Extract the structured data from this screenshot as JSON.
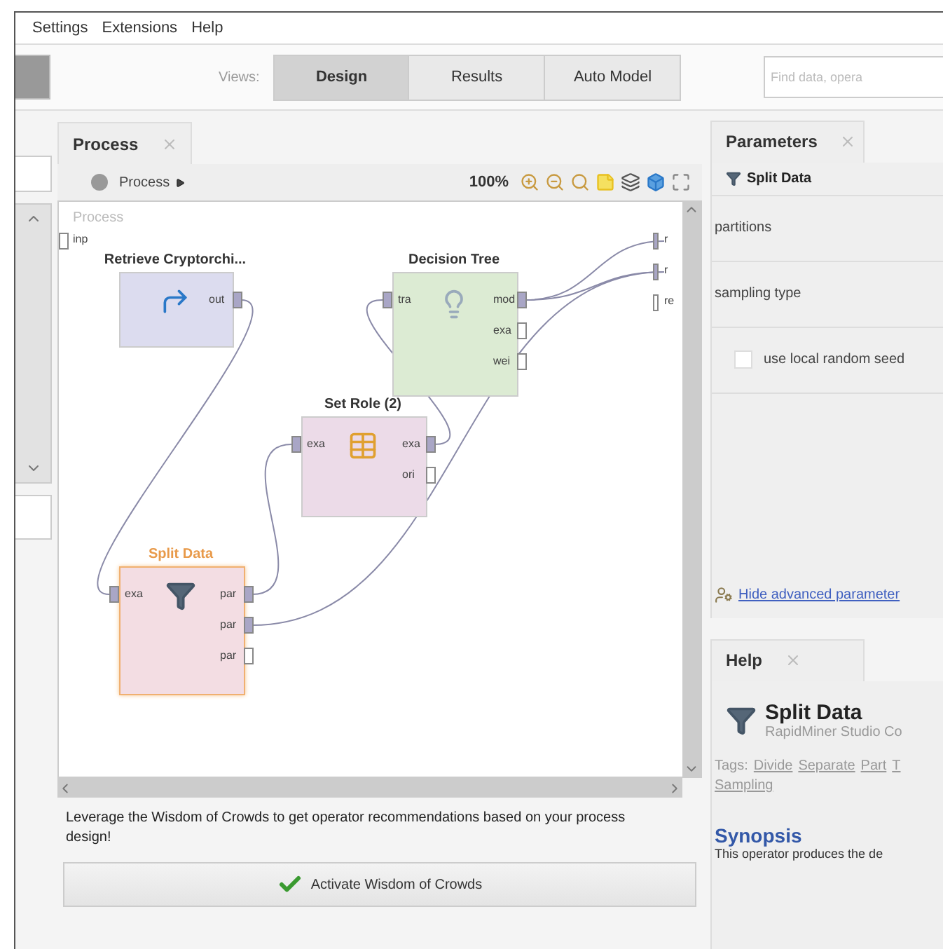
{
  "menu": [
    "Settings",
    "Extensions",
    "Help"
  ],
  "views_label": "Views:",
  "views": [
    {
      "label": "Design",
      "selected": true
    },
    {
      "label": "Results",
      "selected": false
    },
    {
      "label": "Auto Model",
      "selected": false
    }
  ],
  "search": {
    "placeholder": "Find data, opera"
  },
  "process": {
    "tab": "Process",
    "breadcrumb": "Process",
    "zoom": "100%",
    "canvas_label": "Process",
    "process_inputs": [
      {
        "label": "inp",
        "connected": false
      }
    ],
    "process_outputs": [
      {
        "label": "r",
        "connected": true
      },
      {
        "label": "r",
        "connected": true
      },
      {
        "label": "re",
        "connected": false
      }
    ],
    "operators": [
      {
        "title": "Retrieve Cryptorchi...",
        "kind": "retrieve",
        "color": "#dcdcef",
        "selected": false,
        "outputs": [
          {
            "label": "out",
            "connected": true
          }
        ]
      },
      {
        "title": "Decision Tree",
        "kind": "tree",
        "color": "#dcebd3",
        "selected": false,
        "inputs": [
          {
            "label": "tra",
            "connected": true
          }
        ],
        "outputs": [
          {
            "label": "mod",
            "connected": true
          },
          {
            "label": "exa",
            "connected": false
          },
          {
            "label": "wei",
            "connected": false
          }
        ]
      },
      {
        "title": "Set Role (2)",
        "kind": "role",
        "color": "#ecdbe8",
        "selected": false,
        "inputs": [
          {
            "label": "exa",
            "connected": true
          }
        ],
        "outputs": [
          {
            "label": "exa",
            "connected": true
          },
          {
            "label": "ori",
            "connected": false
          }
        ]
      },
      {
        "title": "Split Data",
        "kind": "split",
        "color": "#f3dde3",
        "selected": true,
        "inputs": [
          {
            "label": "exa",
            "connected": true
          }
        ],
        "outputs": [
          {
            "label": "par",
            "connected": true
          },
          {
            "label": "par",
            "connected": true
          },
          {
            "label": "par",
            "connected": false
          }
        ]
      }
    ],
    "wisdom_text": "Leverage the Wisdom of Crowds to get operator recommendations based on your process design!",
    "wisdom_button": "Activate Wisdom of Crowds"
  },
  "parameters": {
    "tab": "Parameters",
    "operator": "Split Data",
    "rows": [
      {
        "kind": "label",
        "label": "partitions"
      },
      {
        "kind": "label",
        "label": "sampling type"
      },
      {
        "kind": "checkbox",
        "label": "use local random seed",
        "checked": false
      }
    ],
    "advanced_link": "Hide advanced parameter"
  },
  "help": {
    "tab": "Help",
    "title": "Split Data",
    "subtitle": "RapidMiner Studio Co",
    "tags_label": "Tags:",
    "tags": [
      "Divide",
      "Separate",
      "Part",
      "T",
      "Sampling"
    ],
    "section": "Synopsis",
    "synopsis": "This operator produces the de"
  }
}
